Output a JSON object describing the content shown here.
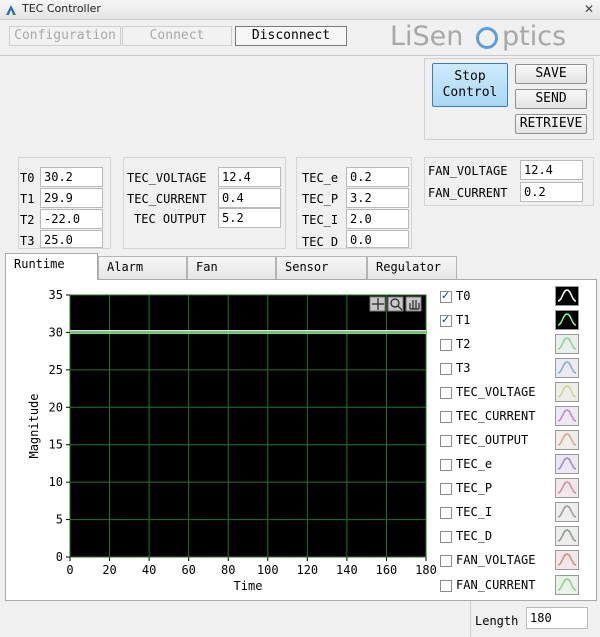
{
  "window": {
    "title": "TEC Controller",
    "close_glyph": "✕"
  },
  "topbar": {
    "configuration": "Configuration",
    "connect": "Connect",
    "disconnect": "Disconnect"
  },
  "logo": {
    "text_left": "LiSen",
    "text_right": "ptics",
    "accent": "#5aa0d8"
  },
  "actions": {
    "stop_line1": "Stop",
    "stop_line2": "Control",
    "save": "SAVE",
    "send": "SEND",
    "retrieve": "RETRIEVE"
  },
  "temps": [
    {
      "label": "T0",
      "value": "30.2"
    },
    {
      "label": "T1",
      "value": "29.9"
    },
    {
      "label": "T2",
      "value": "-22.0"
    },
    {
      "label": "T3",
      "value": "25.0"
    }
  ],
  "tec_output": [
    {
      "label": "TEC_VOLTAGE",
      "value": "12.4"
    },
    {
      "label": "TEC_CURRENT",
      "value": "0.4"
    },
    {
      "label": "TEC OUTPUT",
      "value": "5.2"
    }
  ],
  "pid": [
    {
      "label": "TEC_e",
      "value": "0.2"
    },
    {
      "label": "TEC_P",
      "value": "3.2"
    },
    {
      "label": "TEC_I",
      "value": "2.0"
    },
    {
      "label": "TEC D",
      "value": "0.0"
    }
  ],
  "fan": [
    {
      "label": "FAN_VOLTAGE",
      "value": "12.4"
    },
    {
      "label": "FAN_CURRENT",
      "value": "0.2"
    }
  ],
  "tabs": [
    {
      "label": "Runtime"
    },
    {
      "label": "Alarm"
    },
    {
      "label": "Fan"
    },
    {
      "label": "Sensor"
    },
    {
      "label": "Regulator"
    }
  ],
  "legend": [
    {
      "label": "T0",
      "checked": true,
      "color": "#ffffff",
      "bg": "#000000"
    },
    {
      "label": "T1",
      "checked": true,
      "color": "#7cff7c",
      "bg": "#000000"
    },
    {
      "label": "T2",
      "checked": false,
      "color": "#8ad49a",
      "bg": "#e8eeea"
    },
    {
      "label": "T3",
      "checked": false,
      "color": "#8aa8d4",
      "bg": "#e8ecf2"
    },
    {
      "label": "TEC_VOLTAGE",
      "checked": false,
      "color": "#d4d48a",
      "bg": "#eeeee8"
    },
    {
      "label": "TEC_CURRENT",
      "checked": false,
      "color": "#b48ad4",
      "bg": "#eee8f2"
    },
    {
      "label": "TEC_OUTPUT",
      "checked": false,
      "color": "#d4a88a",
      "bg": "#f2ece8"
    },
    {
      "label": "TEC_e",
      "checked": false,
      "color": "#9a8ad4",
      "bg": "#ebe8f2"
    },
    {
      "label": "TEC_P",
      "checked": false,
      "color": "#d48aa0",
      "bg": "#f2e8ec"
    },
    {
      "label": "TEC_I",
      "checked": false,
      "color": "#9a9a9a",
      "bg": "#eeeeee"
    },
    {
      "label": "TEC_D",
      "checked": false,
      "color": "#8a9a8a",
      "bg": "#ebeeeb"
    },
    {
      "label": "FAN_VOLTAGE",
      "checked": false,
      "color": "#d48a8a",
      "bg": "#f2e8e8"
    },
    {
      "label": "FAN_CURRENT",
      "checked": false,
      "color": "#8ad48a",
      "bg": "#e8f2e8"
    }
  ],
  "chart_data": {
    "type": "line",
    "xlabel": "Time",
    "ylabel": "Magnitude",
    "xlim": [
      0,
      180
    ],
    "ylim": [
      0,
      35
    ],
    "xticks": [
      0,
      20,
      40,
      60,
      80,
      100,
      120,
      140,
      160,
      180
    ],
    "yticks": [
      0,
      5,
      10,
      15,
      20,
      25,
      30,
      35
    ],
    "grid": true,
    "background": "#000000",
    "grid_color": "#1f7a1f",
    "series": [
      {
        "name": "T0",
        "color": "#ffffff",
        "x": [
          0,
          180
        ],
        "y": [
          30.2,
          30.2
        ]
      },
      {
        "name": "T1",
        "color": "#7cff7c",
        "x": [
          0,
          180
        ],
        "y": [
          29.9,
          29.9
        ]
      }
    ]
  },
  "footer": {
    "length_label": "Length",
    "length_value": "180"
  }
}
